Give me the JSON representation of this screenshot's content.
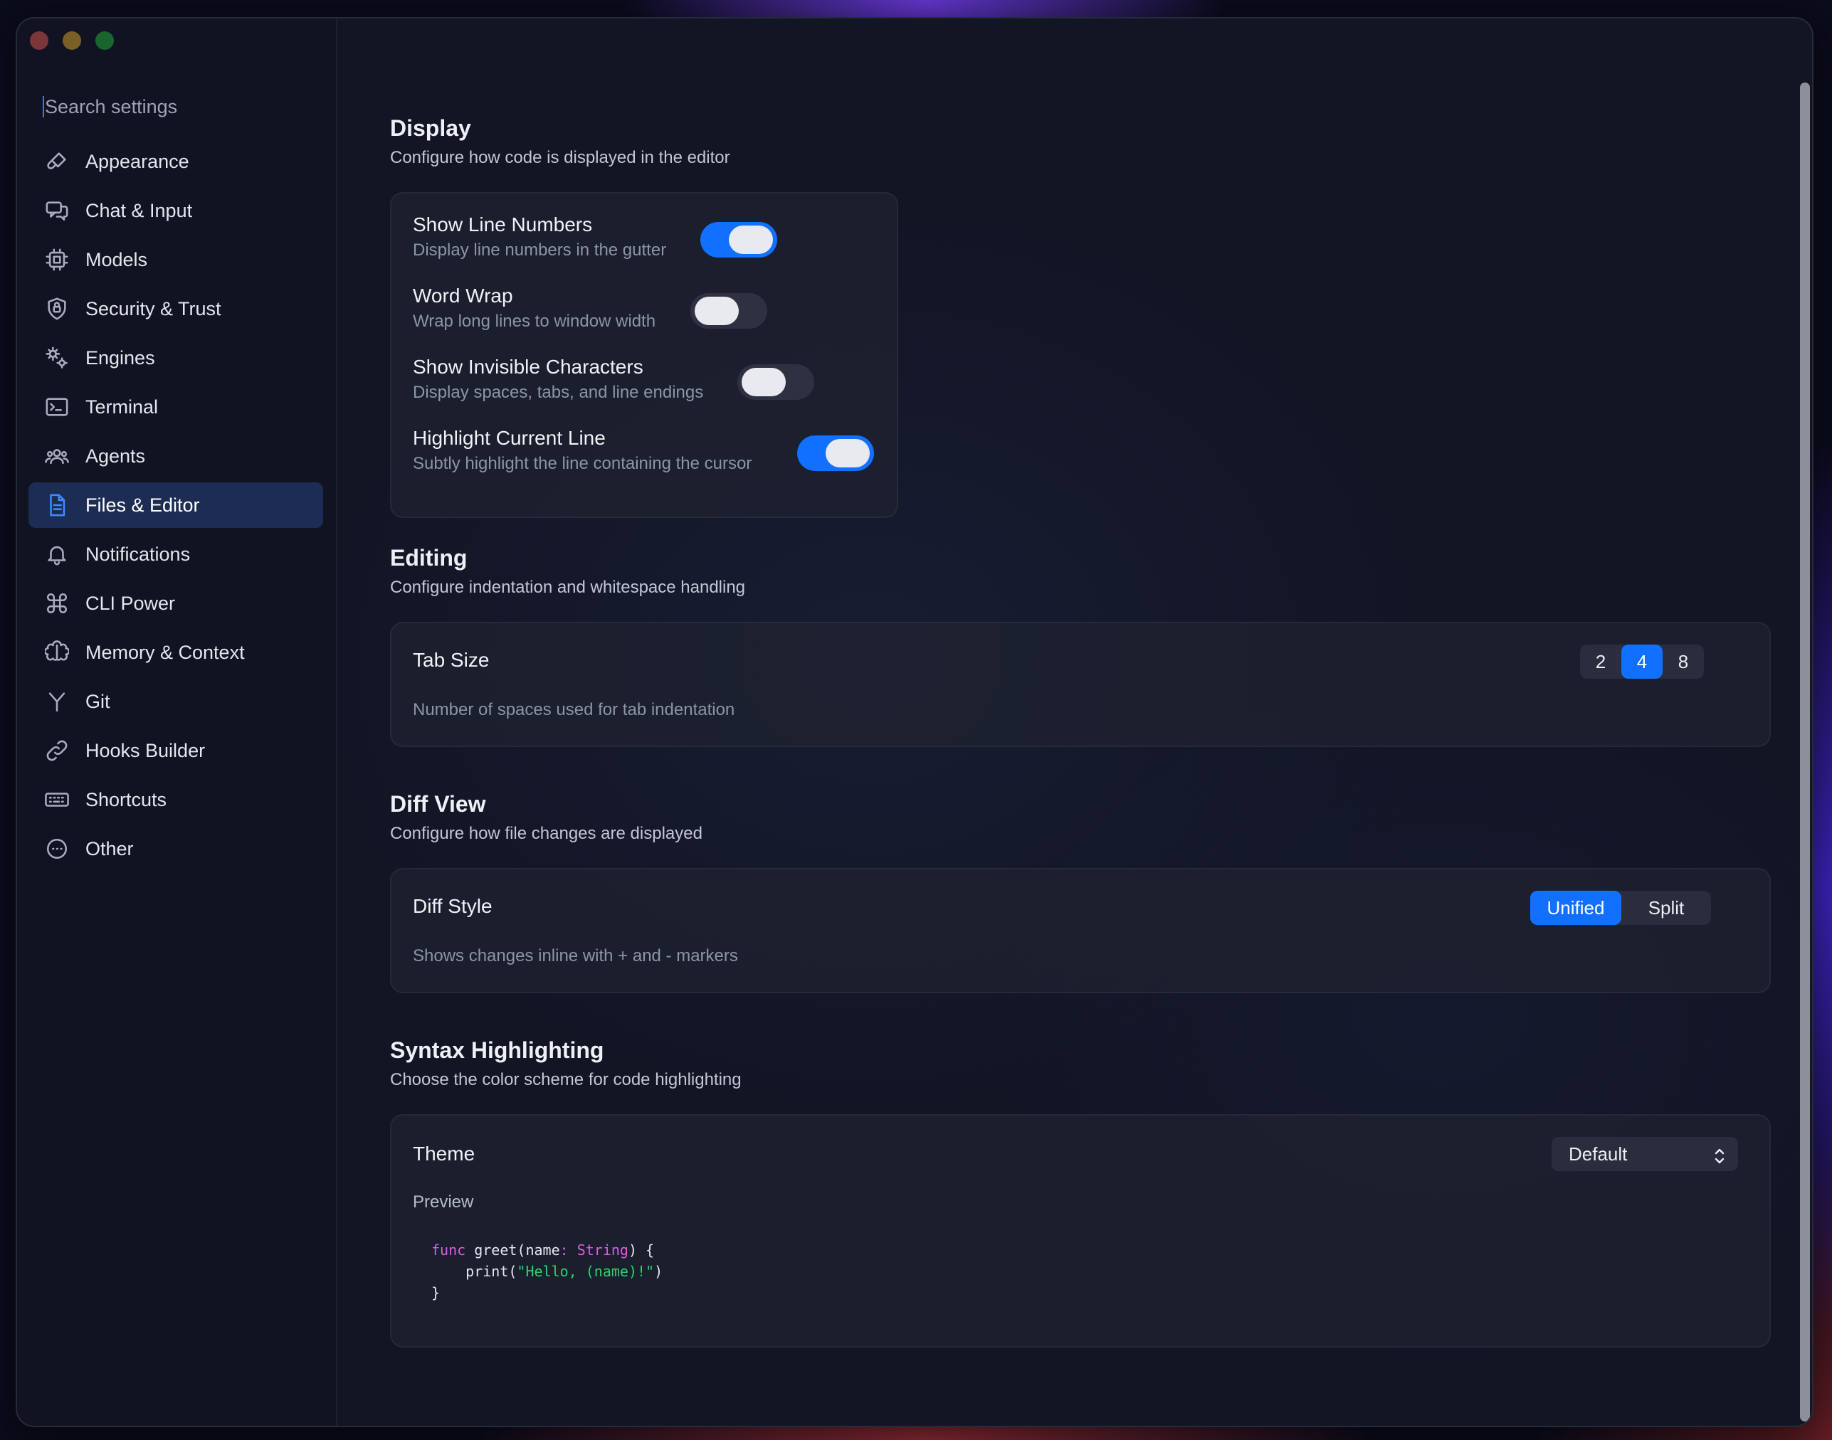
{
  "window": {
    "controls": [
      "close",
      "minimize",
      "zoom"
    ]
  },
  "search": {
    "placeholder": "Search settings"
  },
  "sidebar": {
    "items": [
      {
        "label": "Appearance",
        "icon": "paintbrush-icon"
      },
      {
        "label": "Chat & Input",
        "icon": "chat-bubbles-icon"
      },
      {
        "label": "Models",
        "icon": "cpu-icon"
      },
      {
        "label": "Security & Trust",
        "icon": "shield-icon"
      },
      {
        "label": "Engines",
        "icon": "gears-icon"
      },
      {
        "label": "Terminal",
        "icon": "terminal-icon"
      },
      {
        "label": "Agents",
        "icon": "people-icon"
      },
      {
        "label": "Files & Editor",
        "icon": "document-icon",
        "active": true
      },
      {
        "label": "Notifications",
        "icon": "bell-icon"
      },
      {
        "label": "CLI Power",
        "icon": "command-icon"
      },
      {
        "label": "Memory & Context",
        "icon": "brain-icon"
      },
      {
        "label": "Git",
        "icon": "branch-icon"
      },
      {
        "label": "Hooks Builder",
        "icon": "link-icon"
      },
      {
        "label": "Shortcuts",
        "icon": "keyboard-icon"
      },
      {
        "label": "Other",
        "icon": "ellipsis-circle-icon"
      }
    ]
  },
  "display": {
    "title": "Display",
    "subtitle": "Configure how code is displayed in the editor",
    "rows": [
      {
        "title": "Show Line Numbers",
        "desc": "Display line numbers in the gutter",
        "on": true
      },
      {
        "title": "Word Wrap",
        "desc": "Wrap long lines to window width",
        "on": false
      },
      {
        "title": "Show Invisible Characters",
        "desc": "Display spaces, tabs, and line endings",
        "on": false
      },
      {
        "title": "Highlight Current Line",
        "desc": "Subtly highlight the line containing the cursor",
        "on": true
      }
    ]
  },
  "editing": {
    "title": "Editing",
    "subtitle": "Configure indentation and whitespace handling",
    "tab_size": {
      "label": "Tab Size",
      "desc": "Number of spaces used for tab indentation",
      "options": [
        "2",
        "4",
        "8"
      ],
      "selected": "4"
    }
  },
  "diff": {
    "title": "Diff View",
    "subtitle": "Configure how file changes are displayed",
    "style": {
      "label": "Diff Style",
      "desc": "Shows changes inline with + and - markers",
      "options": [
        "Unified",
        "Split"
      ],
      "selected": "Unified"
    }
  },
  "syntax": {
    "title": "Syntax Highlighting",
    "subtitle": "Choose the color scheme for code highlighting",
    "theme": {
      "label": "Theme",
      "value": "Default"
    },
    "preview_label": "Preview",
    "code": {
      "l1_kw": "func",
      "l1_a": " greet(name",
      "l1_colon": ":",
      "l1_type": " String",
      "l1_b": ") {",
      "l2_a": "    print(",
      "l2_str": "\"Hello, (name)!\"",
      "l2_b": ")",
      "l3": "}"
    }
  },
  "colors": {
    "accent": "#1170ff",
    "keyword": "#d75fe0",
    "string": "#2fd36a"
  }
}
